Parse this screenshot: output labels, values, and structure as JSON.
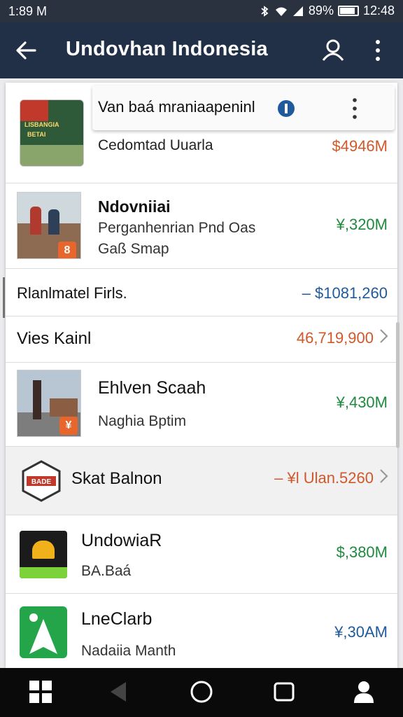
{
  "status_bar": {
    "time": "1:89 M",
    "battery": "89%",
    "clock_right": "12:48",
    "icons": [
      "bluetooth-icon",
      "wifi-icon",
      "signal-icon",
      "battery-icon"
    ]
  },
  "app_bar": {
    "title": "Undovhan Indonesia",
    "icons": [
      "back-arrow-icon",
      "account-icon",
      "more-vert-icon"
    ]
  },
  "floating_card": {
    "text": "Van baá mraniaapeninl",
    "icons": [
      "info-dot-icon",
      "more-vert-icon"
    ]
  },
  "rows": [
    {
      "title": "",
      "subtitle": "Cedomtad Uuarla",
      "amount": "$4946M",
      "amount_color": "#d0582a"
    },
    {
      "title": "Ndovniiai",
      "subtitle": "Perganhenrian Pnd Oas",
      "subtitle2": "Gaß Smap",
      "amount": "¥,320M",
      "amount_color": "#1f8a3e",
      "badge": "8"
    },
    {
      "title": "Rlanlmatel Firls.",
      "amount": "– $1081,260",
      "amount_color": "#1f5b9c"
    },
    {
      "title": "Vies Kainl",
      "amount": "46,719,900",
      "amount_color": "#d0582a"
    },
    {
      "title": "Ehlven Scaah",
      "subtitle": "Naghia Bptim",
      "amount": "¥,430M",
      "amount_color": "#1f8a3e",
      "badge": "¥"
    },
    {
      "title": "Skat Balnon",
      "amount": "– ¥l Ulan.5260",
      "amount_color": "#d0582a",
      "logo_text": "BADE"
    },
    {
      "title": "UndowiaR",
      "subtitle": "BA.Baá",
      "amount": "$,380M",
      "amount_color": "#1f8a3e"
    },
    {
      "title": "LneClarb",
      "subtitle": "Nadaiia Manth",
      "amount": "¥,30AM",
      "amount_color": "#1f5b9c"
    }
  ],
  "thumb_text": {
    "row0": "LISBANGIA",
    "row0b": "BETAI"
  },
  "nav_bar": {
    "icons": [
      "windows-start-icon",
      "back-triangle-icon",
      "home-circle-icon",
      "recents-square-icon",
      "profile-icon"
    ]
  },
  "colors": {
    "status_bg": "#2a3240",
    "app_bar_bg": "#223047",
    "green": "#1f8a3e",
    "orange": "#d0582a",
    "blue": "#1f5b9c"
  }
}
